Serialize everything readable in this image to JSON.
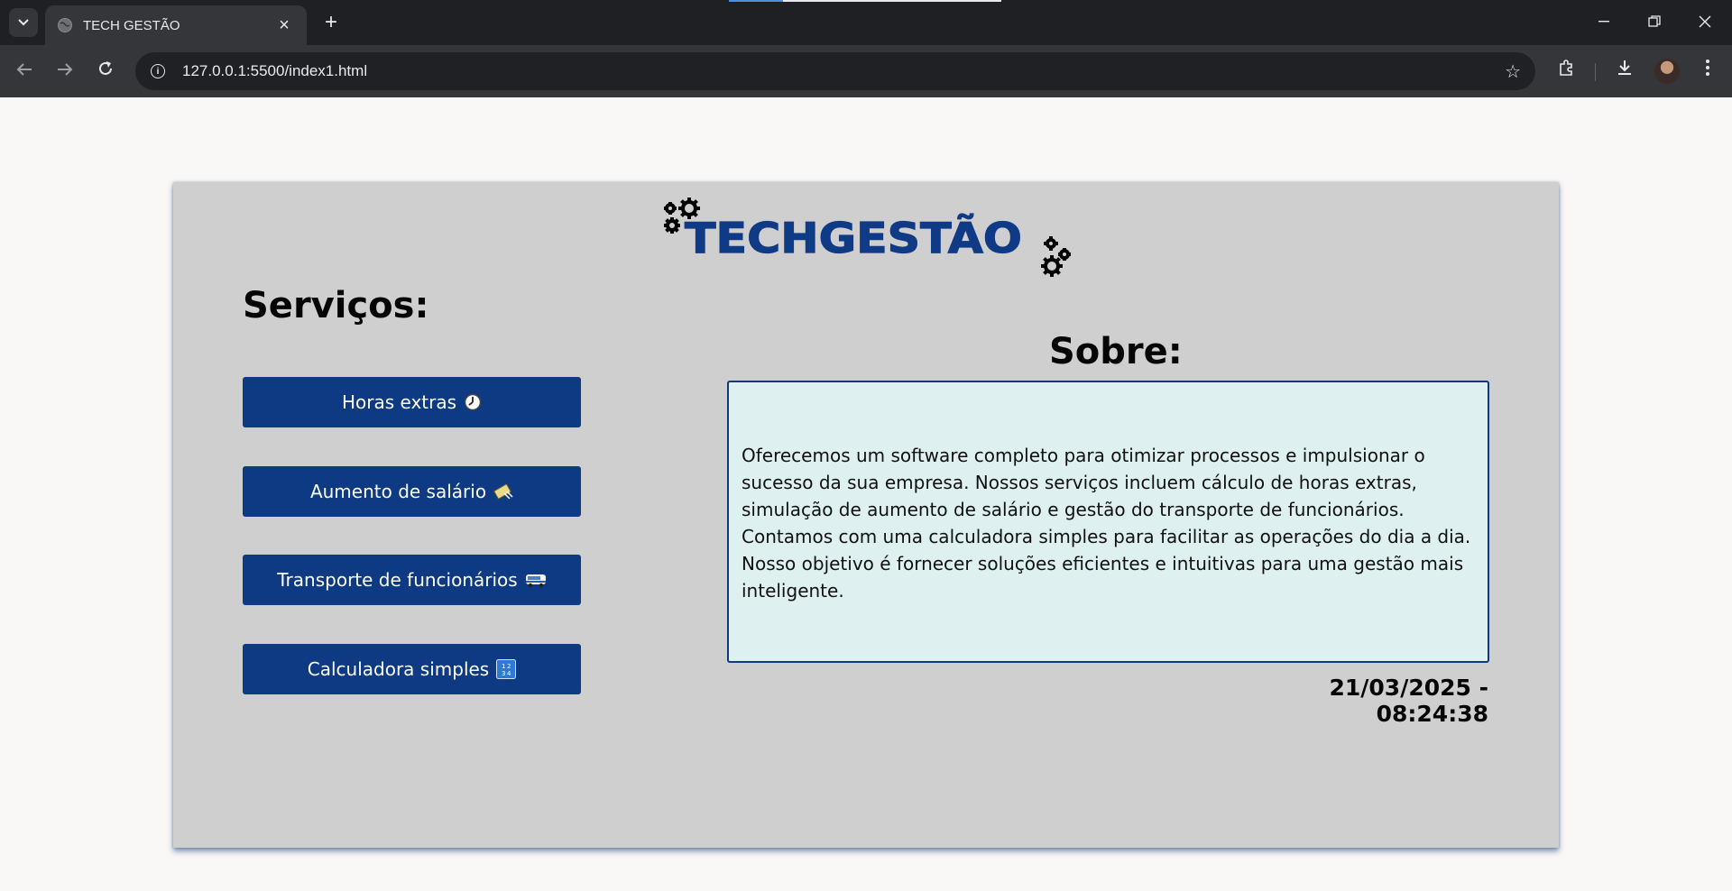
{
  "browser": {
    "tab_title": "TECH GESTÃO",
    "url": "127.0.0.1:5500/index1.html"
  },
  "page": {
    "logo_text": "TECHGESTÃO",
    "services_title": "Serviços:",
    "services": [
      {
        "label": "Horas extras",
        "icon": "clock-icon"
      },
      {
        "label": "Aumento de salário",
        "icon": "money-icon"
      },
      {
        "label": "Transporte de funcionários",
        "icon": "bus-icon"
      },
      {
        "label": "Calculadora simples",
        "icon": "calculator-icon"
      }
    ],
    "about_title": "Sobre:",
    "about_text": "Oferecemos um software completo para otimizar processos e impulsionar o sucesso da sua empresa. Nossos serviços incluem cálculo de horas extras, simulação de aumento de salário e gestão do transporte de funcionários. Contamos com uma calculadora simples para facilitar as operações do dia a dia. Nosso objetivo é fornecer soluções eficientes e intuitivas para uma gestão mais inteligente.",
    "datetime": "21/03/2025 - 08:24:38"
  },
  "colors": {
    "brand_blue": "#0d3a82",
    "card_bg": "#d0cfcf",
    "about_bg": "#dff0f1",
    "page_bg": "#f9f8f6"
  }
}
